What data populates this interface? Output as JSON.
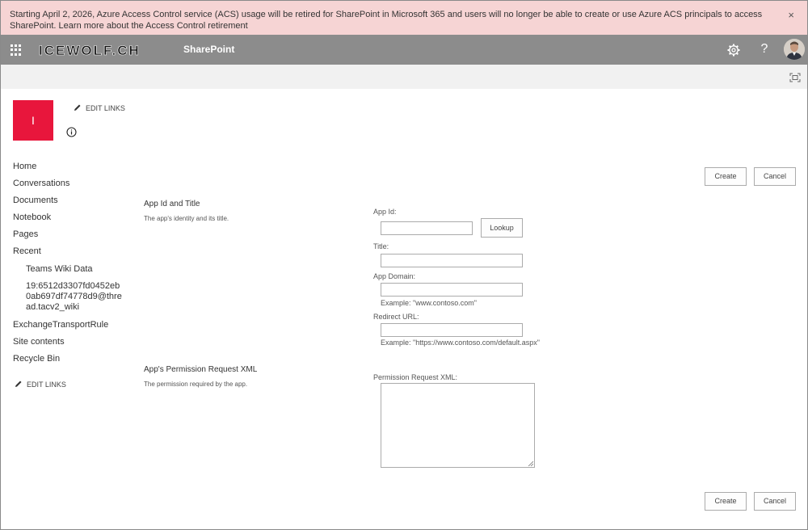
{
  "banner": {
    "message": "Starting April 2, 2026, Azure Access Control service (ACS) usage will be retired for SharePoint in Microsoft 365 and users will no longer be able to create or use Azure ACS principals to access SharePoint.",
    "link": "Learn more about the Access Control retirement",
    "close": "×"
  },
  "suitebar": {
    "brand": "ICEWOLF.CH",
    "title": "SharePoint",
    "help": "?",
    "icons": [
      "waffle-icon",
      "gear-icon",
      "help-icon",
      "avatar"
    ]
  },
  "site": {
    "tile_letter": "I",
    "edit_links": "EDIT LINKS"
  },
  "nav": {
    "items": [
      "Home",
      "Conversations",
      "Documents",
      "Notebook",
      "Pages",
      "Recent"
    ],
    "recent_items": [
      "Teams Wiki Data",
      "19:6512d3307fd0452eb",
      "0ab697df74778d9@thre",
      "ad.tacv2_wiki"
    ],
    "items_after": [
      "ExchangeTransportRule",
      "Site contents",
      "Recycle Bin"
    ],
    "edit_links": "EDIT LINKS"
  },
  "buttons": {
    "create": "Create",
    "cancel": "Cancel",
    "lookup": "Lookup"
  },
  "form": {
    "section1_title": "App Id and Title",
    "section1_desc": "The app's identity and its title.",
    "app_id_label": "App Id:",
    "app_id_value": "",
    "title_label": "Title:",
    "title_value": "",
    "app_domain_label": "App Domain:",
    "app_domain_value": "",
    "app_domain_hint": "Example: \"www.contoso.com\"",
    "redirect_label": "Redirect URL:",
    "redirect_value": "",
    "redirect_hint": "Example: \"https://www.contoso.com/default.aspx\"",
    "section2_title": "App's Permission Request XML",
    "section2_desc": "The permission required by the app.",
    "xml_label": "Permission Request XML:",
    "xml_value": ""
  },
  "colors": {
    "banner_bg": "#f6d4d4",
    "suitebar_bg": "#8c8c8c",
    "site_tile": "#e8163c"
  }
}
